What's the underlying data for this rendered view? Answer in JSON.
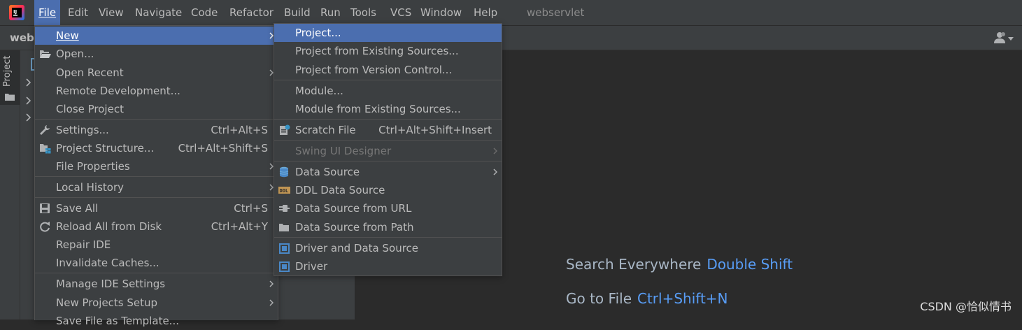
{
  "menubar": {
    "logo_icon": "intellij-idea-logo",
    "items": [
      "File",
      "Edit",
      "View",
      "Navigate",
      "Code",
      "Refactor",
      "Build",
      "Run",
      "Tools",
      "VCS",
      "Window",
      "Help"
    ],
    "window_title": "webservlet"
  },
  "navbar": {
    "breadcrumb": "webs",
    "user_icon": "user-dropdown-icon"
  },
  "stripe": {
    "tab_label": "Project"
  },
  "file_menu": {
    "items": [
      {
        "label": "New",
        "shortcut": "",
        "submenu": true
      },
      {
        "label": "Open...",
        "shortcut": "",
        "icon": "folder-open-icon"
      },
      {
        "label": "Open Recent",
        "shortcut": "",
        "submenu": true
      },
      {
        "label": "Remote Development...",
        "shortcut": ""
      },
      {
        "label": "Close Project",
        "shortcut": ""
      },
      {
        "label": "Settings...",
        "shortcut": "Ctrl+Alt+S",
        "icon": "wrench-icon"
      },
      {
        "label": "Project Structure...",
        "shortcut": "Ctrl+Alt+Shift+S",
        "icon": "project-structure-icon"
      },
      {
        "label": "File Properties",
        "shortcut": "",
        "submenu": true
      },
      {
        "label": "Local History",
        "shortcut": "",
        "submenu": true
      },
      {
        "label": "Save All",
        "shortcut": "Ctrl+S",
        "icon": "save-icon"
      },
      {
        "label": "Reload All from Disk",
        "shortcut": "Ctrl+Alt+Y",
        "icon": "reload-icon"
      },
      {
        "label": "Repair IDE",
        "shortcut": ""
      },
      {
        "label": "Invalidate Caches...",
        "shortcut": ""
      },
      {
        "label": "Manage IDE Settings",
        "shortcut": "",
        "submenu": true
      },
      {
        "label": "New Projects Setup",
        "shortcut": "",
        "submenu": true
      },
      {
        "label": "Save File as Template...",
        "shortcut": ""
      }
    ]
  },
  "new_menu": {
    "items": [
      {
        "label": "Project..."
      },
      {
        "label": "Project from Existing Sources..."
      },
      {
        "label": "Project from Version Control..."
      },
      {
        "label": "Module..."
      },
      {
        "label": "Module from Existing Sources..."
      },
      {
        "label": "Scratch File",
        "shortcut": "Ctrl+Alt+Shift+Insert",
        "icon": "scratch-file-icon"
      },
      {
        "label": "Swing UI Designer",
        "disabled": true,
        "submenu": true
      },
      {
        "label": "Data Source",
        "submenu": true,
        "icon": "database-icon"
      },
      {
        "label": "DDL Data Source",
        "icon": "ddl-icon"
      },
      {
        "label": "Data Source from URL",
        "icon": "plug-icon"
      },
      {
        "label": "Data Source from Path",
        "icon": "folder-icon"
      },
      {
        "label": "Driver and Data Source",
        "icon": "driver-icon"
      },
      {
        "label": "Driver",
        "icon": "driver-icon"
      }
    ]
  },
  "editor": {
    "hints": [
      {
        "action": "Search Everywhere",
        "key": "Double Shift"
      },
      {
        "action": "Go to File",
        "key": "Ctrl+Shift+N"
      }
    ]
  },
  "watermark": "CSDN @恰似情书",
  "colors": {
    "selection": "#4b6eaf",
    "link_key": "#589df6",
    "panel": "#3c3f41",
    "editor_bg": "#2b2b2b"
  }
}
